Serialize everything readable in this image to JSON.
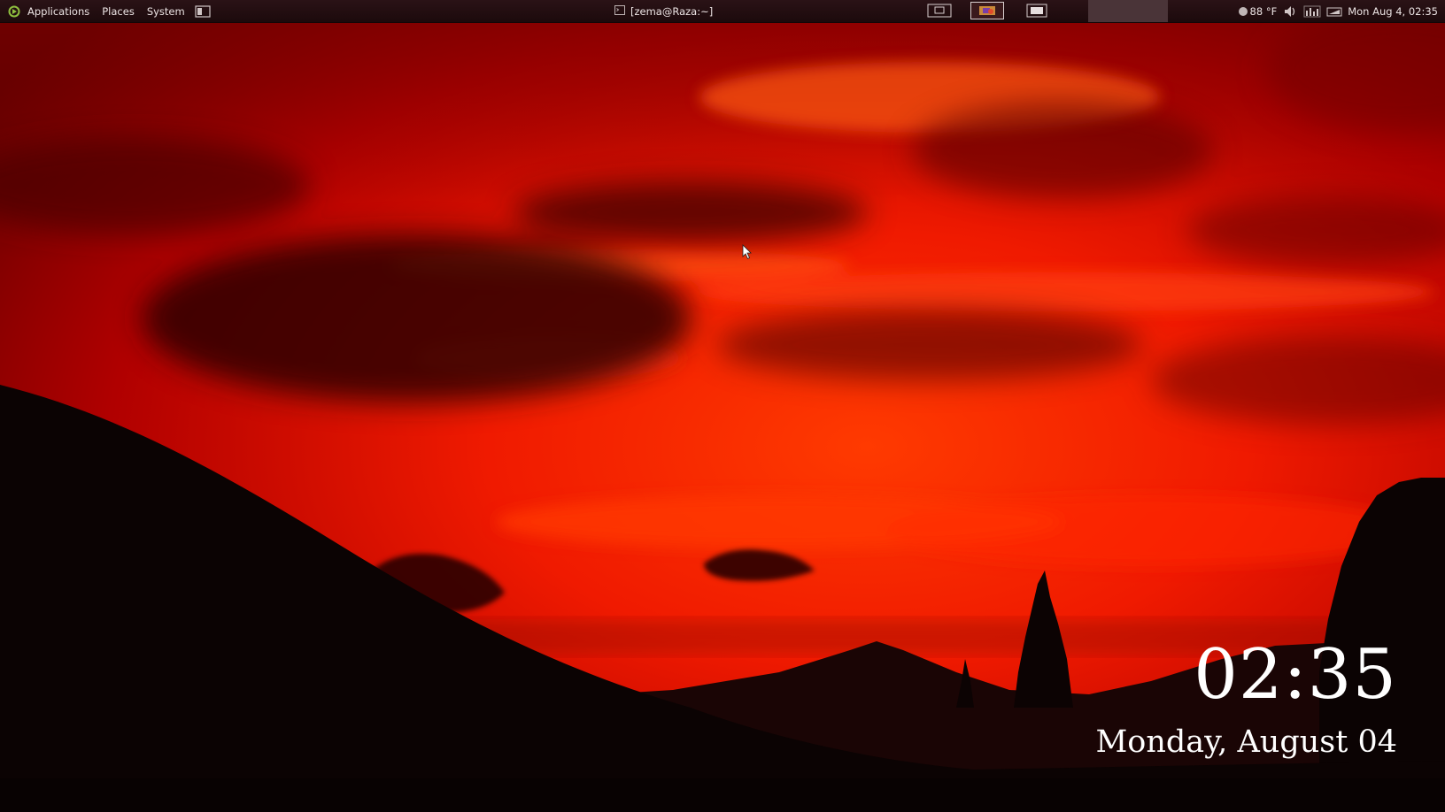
{
  "panel": {
    "menus": [
      {
        "label": "Applications"
      },
      {
        "label": "Places"
      },
      {
        "label": "System"
      }
    ],
    "window_title": "[zema@Raza:~]",
    "tray": {
      "weather": "88 °F",
      "datetime": "Mon Aug 4, 02:35"
    }
  },
  "desktop_clock": {
    "time": "02:35",
    "date": "Monday, August 04"
  },
  "colors": {
    "sky_bright": "#ff2a00",
    "sky_deep": "#c00000",
    "silhouette": "#0b0303",
    "panel_bg": "#1c0a0c"
  }
}
